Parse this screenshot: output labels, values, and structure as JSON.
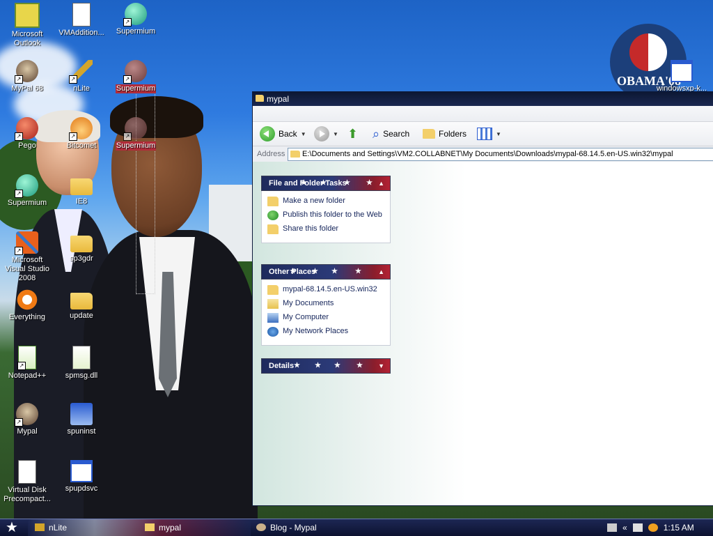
{
  "desktop": {
    "icons": [
      {
        "label": "Microsoft Outlook",
        "icon": "outlook-icon"
      },
      {
        "label": "VMAddition...",
        "icon": "file-icon"
      },
      {
        "label": "Supermium",
        "icon": "supermium-icon"
      },
      {
        "label": "MyPal 68",
        "icon": "mypal-icon"
      },
      {
        "label": "nLite",
        "icon": "nlite-icon"
      },
      {
        "label": "Supermium",
        "icon": "supermium-icon"
      },
      {
        "label": "Pego",
        "icon": "pego-icon"
      },
      {
        "label": "Bitcomet",
        "icon": "bitcomet-icon"
      },
      {
        "label": "Supermium",
        "icon": "supermium-icon"
      },
      {
        "label": "Supermium",
        "icon": "supermium-icon"
      },
      {
        "label": "IE8",
        "icon": "folder-icon"
      },
      {
        "label": "Microsoft Visual Studio 2008",
        "icon": "visual-studio-icon"
      },
      {
        "label": "sp3gdr",
        "icon": "folder-icon"
      },
      {
        "label": "Everything",
        "icon": "everything-icon"
      },
      {
        "label": "update",
        "icon": "folder-icon"
      },
      {
        "label": "Notepad++",
        "icon": "notepad-plus-icon"
      },
      {
        "label": "spmsg.dll",
        "icon": "dll-icon"
      },
      {
        "label": "Mypal",
        "icon": "mypal-icon"
      },
      {
        "label": "spuninst",
        "icon": "installer-icon"
      },
      {
        "label": "Virtual Disk Precompact...",
        "icon": "file-icon"
      },
      {
        "label": "spupdsvc",
        "icon": "window-icon"
      },
      {
        "label": "windowsxp-k...",
        "icon": "window-icon"
      }
    ]
  },
  "window": {
    "title": "mypal",
    "toolbar": {
      "back": "Back",
      "search": "Search",
      "folders": "Folders"
    },
    "address": {
      "label": "Address",
      "path": "E:\\Documents and Settings\\VM2.COLLABNET\\My Documents\\Downloads\\mypal-68.14.5.en-US.win32\\mypal"
    },
    "panels": {
      "file_tasks": {
        "title": "File and Folder Tasks",
        "items": [
          "Make a new folder",
          "Publish this folder to the Web",
          "Share this folder"
        ]
      },
      "other_places": {
        "title": "Other Places",
        "items": [
          "mypal-68.14.5.en-US.win32",
          "My Documents",
          "My Computer",
          "My Network Places"
        ]
      },
      "details": {
        "title": "Details"
      }
    }
  },
  "taskbar": {
    "tasks": [
      "nLite",
      "mypal",
      "Blog - Mypal"
    ],
    "clock": "1:15 AM"
  },
  "colors": {
    "title_bar": "#0c1734",
    "selection": "#b12c3a",
    "panel_blue": "#1e2a5c",
    "panel_red": "#b42234"
  }
}
